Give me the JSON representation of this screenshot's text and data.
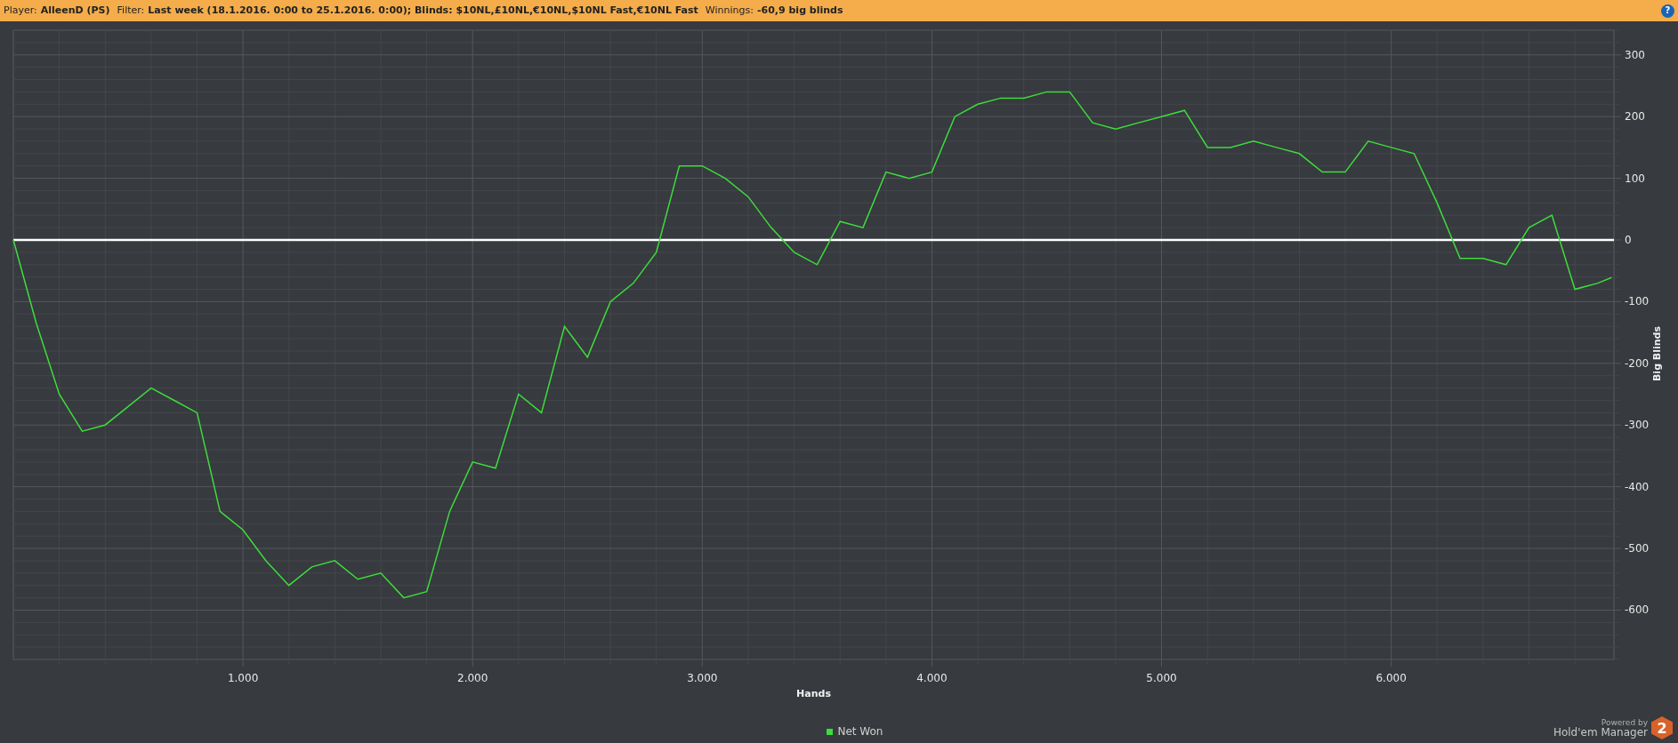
{
  "header": {
    "fields": [
      {
        "label": "Player:",
        "value": "AlleenD (PS)"
      },
      {
        "label": "Filter:",
        "value": "Last week (18.1.2016. 0:00 to 25.1.2016. 0:00); Blinds: $10NL,£10NL,€10NL,$10NL Fast,€10NL Fast"
      },
      {
        "label": "Winnings:",
        "value": "-60,9 big blinds"
      }
    ],
    "help_button": "?"
  },
  "graph": {
    "chart_data": {
      "type": "line",
      "xlabel": "Hands",
      "ylabel": "Big Blinds",
      "x": [
        0,
        100,
        200,
        300,
        400,
        500,
        600,
        700,
        800,
        900,
        1000,
        1100,
        1200,
        1300,
        1400,
        1500,
        1600,
        1700,
        1800,
        1900,
        2000,
        2100,
        2200,
        2300,
        2400,
        2500,
        2600,
        2700,
        2800,
        2900,
        3000,
        3100,
        3200,
        3300,
        3400,
        3500,
        3600,
        3700,
        3800,
        3900,
        4000,
        4100,
        4200,
        4300,
        4400,
        4500,
        4600,
        4700,
        4800,
        4900,
        5000,
        5100,
        5200,
        5300,
        5400,
        5500,
        5600,
        5700,
        5800,
        5900,
        6000,
        6100,
        6200,
        6300,
        6400,
        6500,
        6600,
        6700,
        6800,
        6900,
        6960
      ],
      "series": [
        {
          "name": "Net Won",
          "color": "#3ddc3d",
          "values": [
            0,
            -135,
            -250,
            -310,
            -300,
            -270,
            -240,
            -260,
            -280,
            -440,
            -470,
            -520,
            -560,
            -530,
            -520,
            -550,
            -540,
            -580,
            -570,
            -440,
            -360,
            -370,
            -250,
            -280,
            -140,
            -190,
            -100,
            -70,
            -20,
            120,
            120,
            100,
            70,
            20,
            -20,
            -40,
            30,
            20,
            110,
            100,
            110,
            200,
            220,
            230,
            230,
            240,
            240,
            190,
            180,
            190,
            200,
            210,
            150,
            150,
            160,
            150,
            140,
            110,
            110,
            160,
            150,
            140,
            60,
            -30,
            -30,
            -40,
            20,
            40,
            -80,
            -70,
            -61
          ]
        }
      ],
      "xlim": [
        0,
        6970
      ],
      "ylim": [
        -680,
        340
      ],
      "xticks": [
        {
          "value": 1000,
          "label": "1.000"
        },
        {
          "value": 2000,
          "label": "2.000"
        },
        {
          "value": 3000,
          "label": "3.000"
        },
        {
          "value": 4000,
          "label": "4.000"
        },
        {
          "value": 5000,
          "label": "5.000"
        },
        {
          "value": 6000,
          "label": "6.000"
        }
      ],
      "yticks": [
        300,
        200,
        100,
        0,
        -100,
        -200,
        -300,
        -400,
        -500,
        -600
      ],
      "grid": true
    }
  },
  "branding": {
    "caption": "Powered by",
    "product": "Hold'em Manager",
    "badge": "2"
  }
}
